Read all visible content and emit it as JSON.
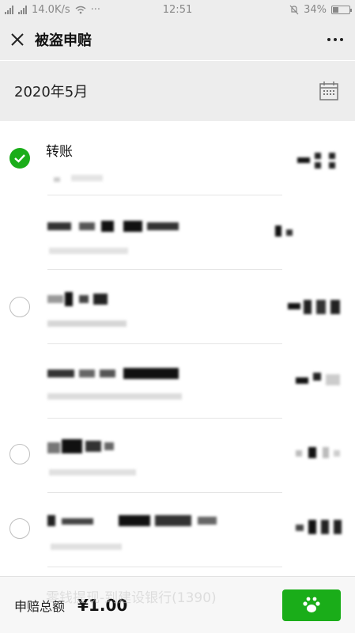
{
  "status_bar": {
    "speed": "14.0K/s",
    "more": "···",
    "time": "12:51",
    "battery": "34%",
    "battery_level": 0.34
  },
  "nav": {
    "title": "被盗申赔",
    "close_icon": "close-icon",
    "more_icon": "more-icon"
  },
  "month": {
    "label": "2020年5月",
    "calendar_icon": "calendar-icon"
  },
  "transactions": [
    {
      "title": "转账",
      "selected": true,
      "has_checkbox": true
    },
    {
      "title": "",
      "selected": false,
      "has_checkbox": false
    },
    {
      "title": "",
      "selected": false,
      "has_checkbox": true
    },
    {
      "title": "",
      "selected": false,
      "has_checkbox": false
    },
    {
      "title": "",
      "selected": false,
      "has_checkbox": true
    },
    {
      "title": "",
      "selected": false,
      "has_checkbox": true
    }
  ],
  "footer": {
    "total_label": "申赔总额",
    "total_amount": "¥1.00",
    "submit_icon": "submit-button",
    "watermark": "零钱提现-到建设银行(1390)"
  },
  "colors": {
    "accent": "#1aad19",
    "header_bg": "#ededed",
    "divider": "#e5e5e5"
  }
}
